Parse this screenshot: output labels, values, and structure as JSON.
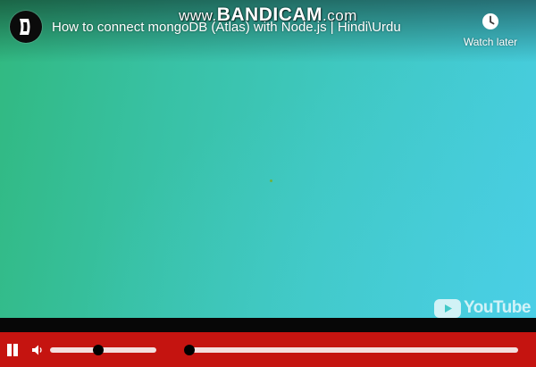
{
  "video": {
    "title": "How to connect mongoDB (Atlas) with Node.js | Hindi\\Urdu",
    "watermark_prefix": "www.",
    "watermark_brand": "BANDICAM",
    "watermark_suffix": ".com"
  },
  "watch_later": {
    "label": "Watch later",
    "icon": "clock-icon"
  },
  "branding": {
    "logo_text": "YouTube",
    "icon": "youtube-play-icon"
  },
  "controls": {
    "pause_icon": "pause-icon",
    "volume_icon": "speaker-icon",
    "volume_level": 0.45,
    "progress_fraction": 0.0
  },
  "colors": {
    "control_bar": "#c51410",
    "track": "#f3dfdf",
    "knob": "#000000",
    "video_gradient_start": "#31b980",
    "video_gradient_end": "#47cde1"
  }
}
